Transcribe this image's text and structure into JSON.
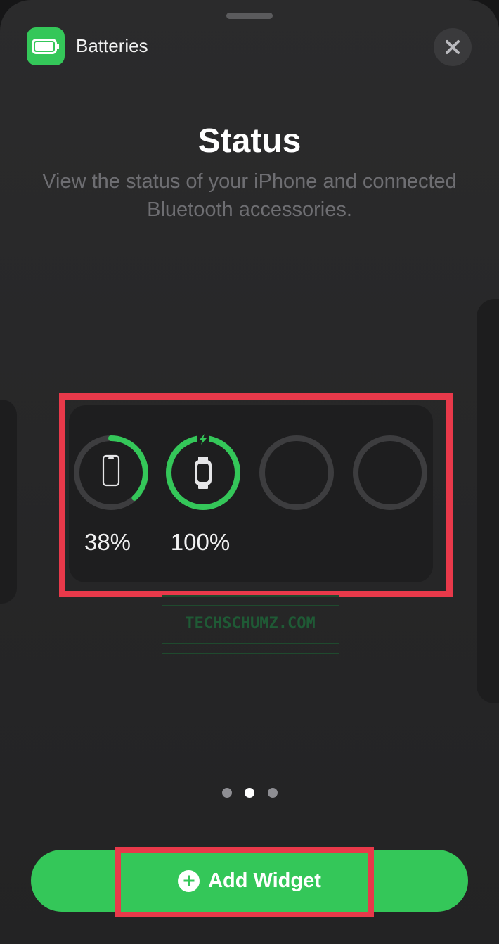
{
  "app": {
    "name": "Batteries",
    "icon": "battery-icon"
  },
  "header": {
    "close_icon": "close-icon"
  },
  "widget_info": {
    "title": "Status",
    "description": "View the status of your iPhone and connected Bluetooth accessories."
  },
  "widget": {
    "devices": [
      {
        "device": "iPhone",
        "icon": "iphone-icon",
        "level": 0.38,
        "percent_label": "38%",
        "charging": false
      },
      {
        "device": "Apple Watch",
        "icon": "watch-icon",
        "level": 1.0,
        "percent_label": "100%",
        "charging": true
      },
      {
        "device": "",
        "icon": "",
        "level": 0,
        "percent_label": "",
        "charging": false
      },
      {
        "device": "",
        "icon": "",
        "level": 0,
        "percent_label": "",
        "charging": false
      }
    ]
  },
  "watermark": {
    "text": "TECHSCHUMZ.COM"
  },
  "pagination": {
    "pages": 3,
    "current_index": 1
  },
  "actions": {
    "add_widget_label": "Add Widget",
    "add_icon": "plus-circle-icon"
  },
  "colors": {
    "accent_green": "#34c759",
    "highlight_red": "#e8394a",
    "ring_track": "#3d3d3f",
    "background": "#262627"
  }
}
